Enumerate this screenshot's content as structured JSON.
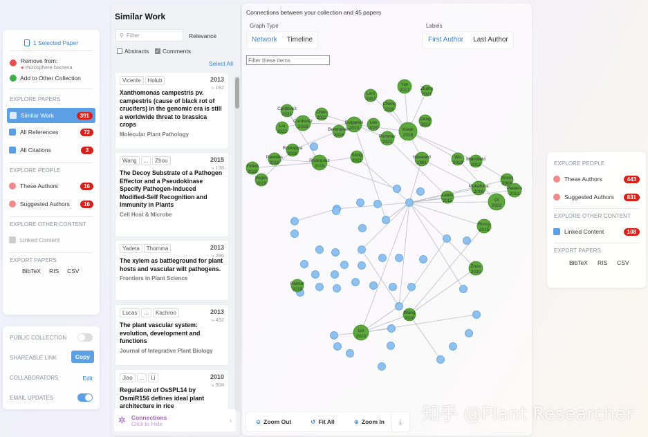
{
  "left_panel": {
    "selected_papers": "1 Selected Paper",
    "remove_from": "Remove from:",
    "remove_collection": "rhizosphere bacteria",
    "add_to_other": "Add to Other Collection",
    "explore_papers_header": "EXPLORE PAPERS",
    "similar_work": "Similar Work",
    "similar_work_count": "391",
    "all_references": "All References",
    "all_references_count": "72",
    "all_citations": "All Citations",
    "all_citations_count": "3",
    "explore_people_header": "EXPLORE PEOPLE",
    "these_authors": "These Authors",
    "these_authors_count": "16",
    "suggested_authors": "Suggested Authors",
    "suggested_authors_count": "16",
    "explore_other_header": "EXPLORE OTHER CONTENT",
    "linked_content": "Linked Content",
    "export_header": "EXPORT PAPERS",
    "export": [
      "BibTeX",
      "RIS",
      "CSV"
    ]
  },
  "settings_panel": {
    "public_collection": "PUBLIC COLLECTION",
    "shareable_link": "SHAREABLE LINK",
    "copy": "Copy",
    "collaborators": "COLLABORATORS",
    "edit": "Edit",
    "email_updates": "EMAIL UPDATES"
  },
  "similar": {
    "title": "Similar Work",
    "filter_placeholder": "Filter",
    "sort": "Relevance",
    "abstracts": "Abstracts",
    "comments": "Comments",
    "select_all": "Select All",
    "papers": [
      {
        "authors": [
          "Vicente",
          "Holub"
        ],
        "year": "2013",
        "cites": "192",
        "title": "Xanthomonas campestris pv. campestris (cause of black rot of crucifers) in the genomic era is still a worldwide threat to brassica crops",
        "journal": "Molecular Plant Pathology"
      },
      {
        "authors": [
          "Wang",
          "...",
          "Zhou"
        ],
        "year": "2015",
        "cites": "138",
        "title": "The Decoy Substrate of a Pathogen Effector and a Pseudokinase Specify Pathogen-Induced Modified-Self Recognition and Immunity in Plants",
        "journal": "Cell Host & Microbe"
      },
      {
        "authors": [
          "Yadeta",
          "Thomma"
        ],
        "year": "2013",
        "cites": "296",
        "title": "The xylem as battleground for plant hosts and vascular wilt pathogens.",
        "journal": "Frontiers in Plant Science"
      },
      {
        "authors": [
          "Lucas",
          "...",
          "Kachroo"
        ],
        "year": "2013",
        "cites": "432",
        "title": "The plant vascular system: evolution, development and functions",
        "journal": "Journal of Integrative Plant Biology"
      },
      {
        "authors": [
          "Jiao",
          "...",
          "Li"
        ],
        "year": "2010",
        "cites": "908",
        "title": "Regulation of OsSPL14 by OsmiR156 defines ideal plant architecture in rice",
        "journal": ""
      }
    ],
    "connections": "Connections",
    "connections_sub": "Click to Hide"
  },
  "graph": {
    "header": "Connections between your collection and 45 papers",
    "graph_type": "Graph Type",
    "network": "Network",
    "timeline": "Timeline",
    "labels": "Labels",
    "first_author": "First Author",
    "last_author": "Last Author",
    "filter_placeholder": "Filter these items",
    "zoom_out": "Zoom Out",
    "fit_all": "Fit All",
    "zoom_in": "Zoom In",
    "green_nodes": [
      {
        "l": "Linn",
        "y": "2022"
      },
      {
        "l": "Yan",
        "y": "2017"
      },
      {
        "l": "Zhang",
        "y": "2021"
      },
      {
        "l": "Cheng",
        "y": "2020"
      },
      {
        "l": "Cordovez",
        "y": "2021"
      },
      {
        "l": "Chen",
        "y": "2022"
      },
      {
        "l": "Cordovez",
        "y": "2019"
      },
      {
        "l": "Liu",
        "y": "2022"
      },
      {
        "l": "Bulgarelli",
        "y": "2013"
      },
      {
        "l": "Lee",
        "y": "2020"
      },
      {
        "l": "Kwak",
        "y": "2018"
      },
      {
        "l": "Deng",
        "y": "2022"
      },
      {
        "l": "Berendsen",
        "y": "2018"
      },
      {
        "l": "Pommer",
        "y": "2021"
      },
      {
        "l": "Rudrappa",
        "y": "2008"
      },
      {
        "l": "Paredes",
        "y": "2018"
      },
      {
        "l": "Rodriguez",
        "y": "2019"
      },
      {
        "l": "Song",
        "y": "2021"
      },
      {
        "l": "Havward",
        "y": "1991"
      },
      {
        "l": "Wu",
        "y": "2019"
      },
      {
        "l": "Mansfield",
        "y": "2012"
      },
      {
        "l": "Finkel",
        "y": "2020"
      },
      {
        "l": "Voges",
        "y": "2019"
      },
      {
        "l": "Ancot",
        "y": "2006"
      },
      {
        "l": "Mukahara",
        "y": "2016"
      },
      {
        "l": "Peeters",
        "y": "2013"
      },
      {
        "l": "Lewis",
        "y": "2015"
      },
      {
        "l": "Oi",
        "y": "2022"
      },
      {
        "l": "Rossy",
        "y": "2015"
      },
      {
        "l": "Zhou",
        "y": "2020"
      },
      {
        "l": "Palmer",
        "y": "2019"
      },
      {
        "l": "Wang",
        "y": "2020"
      },
      {
        "l": "Lin",
        "y": "2022"
      }
    ]
  },
  "right_panel": {
    "explore_people": "EXPLORE PEOPLE",
    "these_authors": "These Authors",
    "these_authors_count": "443",
    "suggested_authors": "Suggested Authors",
    "suggested_authors_count": "831",
    "explore_other": "EXPLORE OTHER CONTENT",
    "linked_content": "Linked Content",
    "linked_content_count": "108",
    "export": "EXPORT PAPERS",
    "export_items": [
      "BibTeX",
      "RIS",
      "CSV"
    ]
  },
  "watermark": "知乎 @Plant Researcher"
}
